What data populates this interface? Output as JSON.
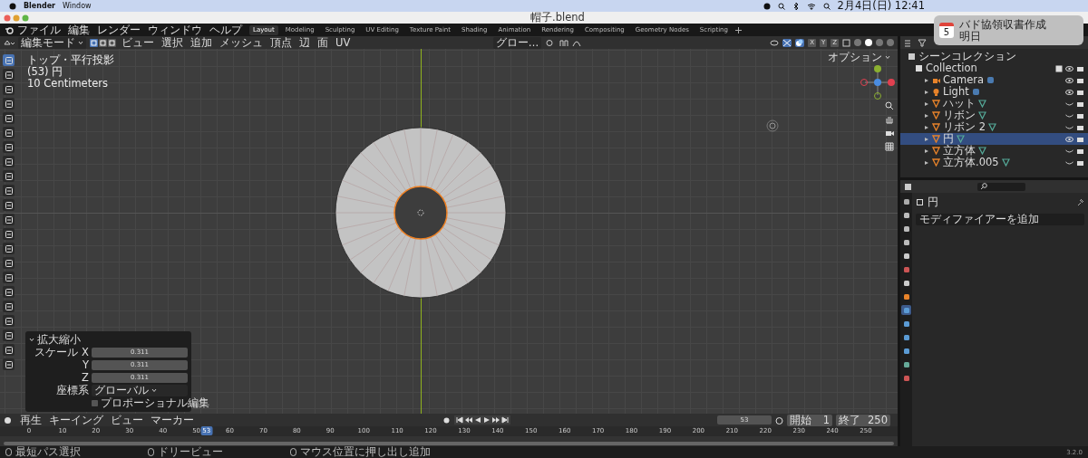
{
  "mac_menubar": {
    "app": "Blender",
    "menus": [
      "Window"
    ],
    "clock": "2月4日(日) 12:41"
  },
  "window": {
    "title": "帽子.blend"
  },
  "notification": {
    "day": "5",
    "title": "バド協領収書作成",
    "subtitle": "明日"
  },
  "menu": [
    "ファイル",
    "編集",
    "レンダー",
    "ウィンドウ",
    "ヘルプ"
  ],
  "workspaces": [
    {
      "label": "Layout",
      "selected": true
    },
    {
      "label": "Modeling",
      "selected": false
    },
    {
      "label": "Sculpting",
      "selected": false
    },
    {
      "label": "UV Editing",
      "selected": false
    },
    {
      "label": "Texture Paint",
      "selected": false
    },
    {
      "label": "Shading",
      "selected": false
    },
    {
      "label": "Animation",
      "selected": false
    },
    {
      "label": "Rendering",
      "selected": false
    },
    {
      "label": "Compositing",
      "selected": false
    },
    {
      "label": "Geometry Nodes",
      "selected": false
    },
    {
      "label": "Scripting",
      "selected": false
    }
  ],
  "header": {
    "mode": "編集モード",
    "select_modes": [
      {
        "selected": true
      },
      {
        "selected": false
      },
      {
        "selected": false
      }
    ],
    "menus": [
      "ビュー",
      "選択",
      "追加",
      "メッシュ",
      "頂点",
      "辺",
      "面",
      "UV"
    ],
    "orientation": "グロー…",
    "mirror_axes": [
      "X",
      "Y",
      "Z"
    ],
    "shading_modes": [
      {
        "selected": false
      },
      {
        "selected": true
      },
      {
        "selected": false
      },
      {
        "selected": false
      }
    ]
  },
  "viewport": {
    "info": [
      "トップ・平行投影",
      "(53) 円",
      "10 Centimeters"
    ],
    "options": "オプション"
  },
  "tools": [
    {
      "selected": true
    },
    {
      "selected": false
    },
    {
      "selected": false
    },
    {
      "selected": false
    },
    {
      "selected": false
    },
    {
      "selected": false
    },
    {
      "selected": false
    },
    {
      "selected": false
    },
    {
      "selected": false
    },
    {
      "selected": false
    },
    {
      "selected": false
    },
    {
      "selected": false
    },
    {
      "selected": false
    },
    {
      "selected": false
    },
    {
      "selected": false
    },
    {
      "selected": false
    },
    {
      "selected": false
    },
    {
      "selected": false
    },
    {
      "selected": false
    },
    {
      "selected": false
    },
    {
      "selected": false
    },
    {
      "selected": false
    }
  ],
  "operator_panel": {
    "title": "拡大縮小",
    "fields": [
      {
        "label": "スケール X",
        "value": "0.311"
      },
      {
        "label": "Y",
        "value": "0.311"
      },
      {
        "label": "Z",
        "value": "0.311"
      }
    ],
    "orientation_label": "座標系",
    "orientation": "グローバル",
    "proportional": {
      "label": "プロポーショナル編集",
      "checked": false
    }
  },
  "timeline": {
    "menus": [
      "再生",
      "キーイング",
      "ビュー",
      "マーカー"
    ],
    "current_frame": "53",
    "start_label": "開始",
    "start": "1",
    "end_label": "終了",
    "end": "250",
    "ticks": [
      "0",
      "10",
      "20",
      "30",
      "40",
      "50",
      "60",
      "70",
      "80",
      "90",
      "100",
      "110",
      "120",
      "130",
      "140",
      "150",
      "160",
      "170",
      "180",
      "190",
      "200",
      "210",
      "220",
      "230",
      "240",
      "250"
    ],
    "playhead": {
      "label": "53",
      "level": 0.212
    }
  },
  "outliner": {
    "root": "シーンコレクション",
    "collection": {
      "name": "Collection",
      "children": [
        {
          "name": "Camera",
          "kind": "camera",
          "visible": true,
          "selected": false
        },
        {
          "name": "Light",
          "kind": "light",
          "visible": true,
          "selected": false
        },
        {
          "name": "ハット",
          "kind": "mesh",
          "visible": false,
          "selected": false
        },
        {
          "name": "リボン",
          "kind": "mesh",
          "visible": false,
          "selected": false
        },
        {
          "name": "リボン 2",
          "kind": "mesh",
          "visible": false,
          "selected": false
        },
        {
          "name": "円",
          "kind": "mesh",
          "visible": true,
          "selected": true
        },
        {
          "name": "立方体",
          "kind": "mesh",
          "visible": false,
          "selected": false
        },
        {
          "name": "立方体.005",
          "kind": "mesh",
          "visible": false,
          "selected": false
        }
      ]
    }
  },
  "properties": {
    "object": "円",
    "add_modifier": "モディファイアーを追加",
    "tabs": [
      {
        "selected": false
      },
      {
        "selected": false
      },
      {
        "selected": false
      },
      {
        "selected": false
      },
      {
        "selected": false
      },
      {
        "selected": false
      },
      {
        "selected": false
      },
      {
        "selected": false
      },
      {
        "selected": true
      },
      {
        "selected": false
      },
      {
        "selected": false
      },
      {
        "selected": false
      },
      {
        "selected": false
      },
      {
        "selected": false
      }
    ]
  },
  "status_bar": {
    "items": [
      "最短パス選択",
      "ドリービュー",
      "マウス位置に押し出し追加"
    ],
    "version": "3.2.0"
  }
}
